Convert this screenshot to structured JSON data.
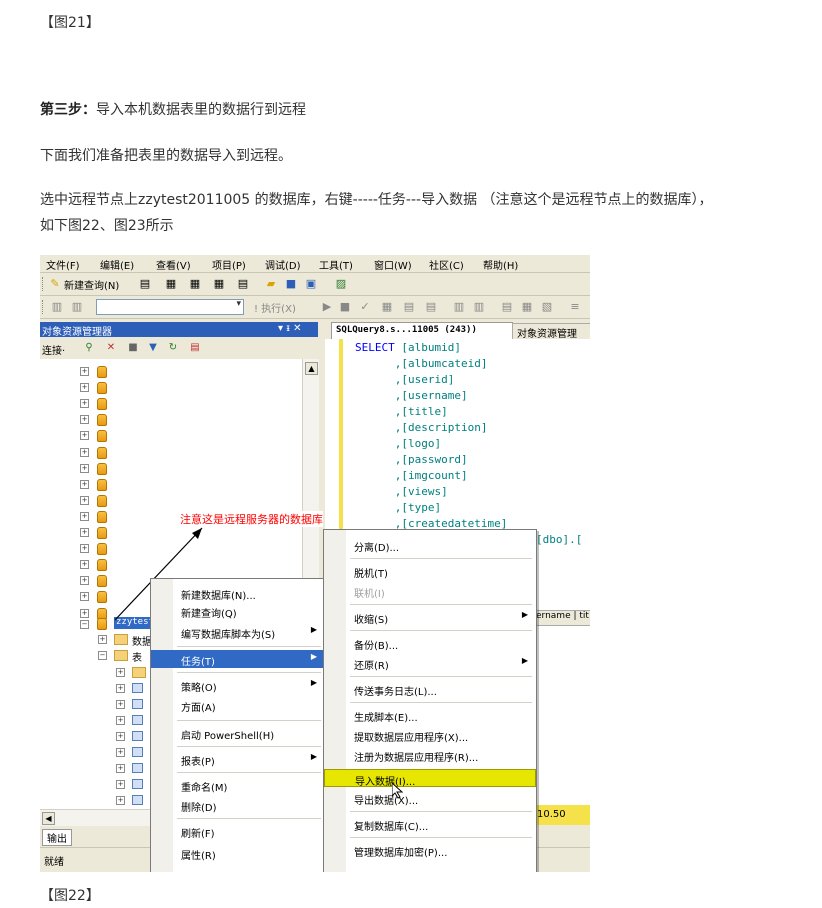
{
  "article": {
    "fig21_caption": "【图21】",
    "step3_label": "第三步：",
    "step3_text": "导入本机数据表里的数据行到远程",
    "para1": "下面我们准备把表里的数据导入到远程。",
    "para2_line1": "选中远程节点上zzytest2011005 的数据库，右键-----任务---导入数据 （注意这个是远程节点上的数据库），",
    "para2_line2": "如下图22、图23所示",
    "fig22_caption": "【图22】"
  },
  "screenshot": {
    "menubar": [
      "文件(F)",
      "编辑(E)",
      "查看(V)",
      "项目(P)",
      "调试(D)",
      "工具(T)",
      "窗口(W)",
      "社区(C)",
      "帮助(H)"
    ],
    "toolbar_new_query": "新建查询(N)",
    "toolbar_execute": "! 执行(X)",
    "object_explorer": {
      "title": "对象资源管理器",
      "pin_close": "▾ ᵻ ✕",
      "connect": "连接·",
      "db_node": "zzytest",
      "db_sub_data": "数据",
      "db_sub_tables": "表"
    },
    "editor": {
      "tab_active": "SQLQuery8.s...11005 (243))",
      "tab_other": "对象资源管理",
      "code_lines": [
        "SELECT [albumid]",
        "      ,[albumcateid]",
        "      ,[userid]",
        "      ,[username]",
        "      ,[title]",
        "      ,[description]",
        "      ,[logo]",
        "      ,[password]",
        "      ,[imgcount]",
        "      ,[views]",
        "      ,[type]",
        "      ,[createdatetime]"
      ],
      "from_fragment": "[dbo].[",
      "grid_header": "ername | tit",
      "result_value": "10.50"
    },
    "annotation": "注意这是远程服务器的数据库",
    "context_menu": {
      "items": [
        {
          "label": "新建数据库(N)...",
          "submenu": false
        },
        {
          "label": "新建查询(Q)",
          "submenu": false
        },
        {
          "label": "编写数据库脚本为(S)",
          "submenu": true
        },
        {
          "label": "任务(T)",
          "submenu": true
        },
        {
          "label": "策略(O)",
          "submenu": true
        },
        {
          "label": "方面(A)",
          "submenu": false
        },
        {
          "label": "启动 PowerShell(H)",
          "submenu": false
        },
        {
          "label": "报表(P)",
          "submenu": true
        },
        {
          "label": "重命名(M)",
          "submenu": false
        },
        {
          "label": "删除(D)",
          "submenu": false
        },
        {
          "label": "刷新(F)",
          "submenu": false
        },
        {
          "label": "属性(R)",
          "submenu": false
        }
      ]
    },
    "tasks_menu": {
      "items": [
        {
          "label": "分离(D)...",
          "submenu": false
        },
        {
          "label": "脱机(T)",
          "submenu": false
        },
        {
          "label": "联机(I)",
          "submenu": false
        },
        {
          "label": "收缩(S)",
          "submenu": true
        },
        {
          "label": "备份(B)...",
          "submenu": false
        },
        {
          "label": "还原(R)",
          "submenu": true
        },
        {
          "label": "传送事务日志(L)...",
          "submenu": false
        },
        {
          "label": "生成脚本(E)...",
          "submenu": false
        },
        {
          "label": "提取数据层应用程序(X)...",
          "submenu": false
        },
        {
          "label": "注册为数据层应用程序(R)...",
          "submenu": false
        },
        {
          "label": "导入数据(I)...",
          "submenu": false
        },
        {
          "label": "导出数据(X)...",
          "submenu": false
        },
        {
          "label": "复制数据库(C)...",
          "submenu": false
        },
        {
          "label": "管理数据库加密(P)...",
          "submenu": false
        }
      ]
    },
    "output_tab": "输出",
    "status": "就绪"
  }
}
